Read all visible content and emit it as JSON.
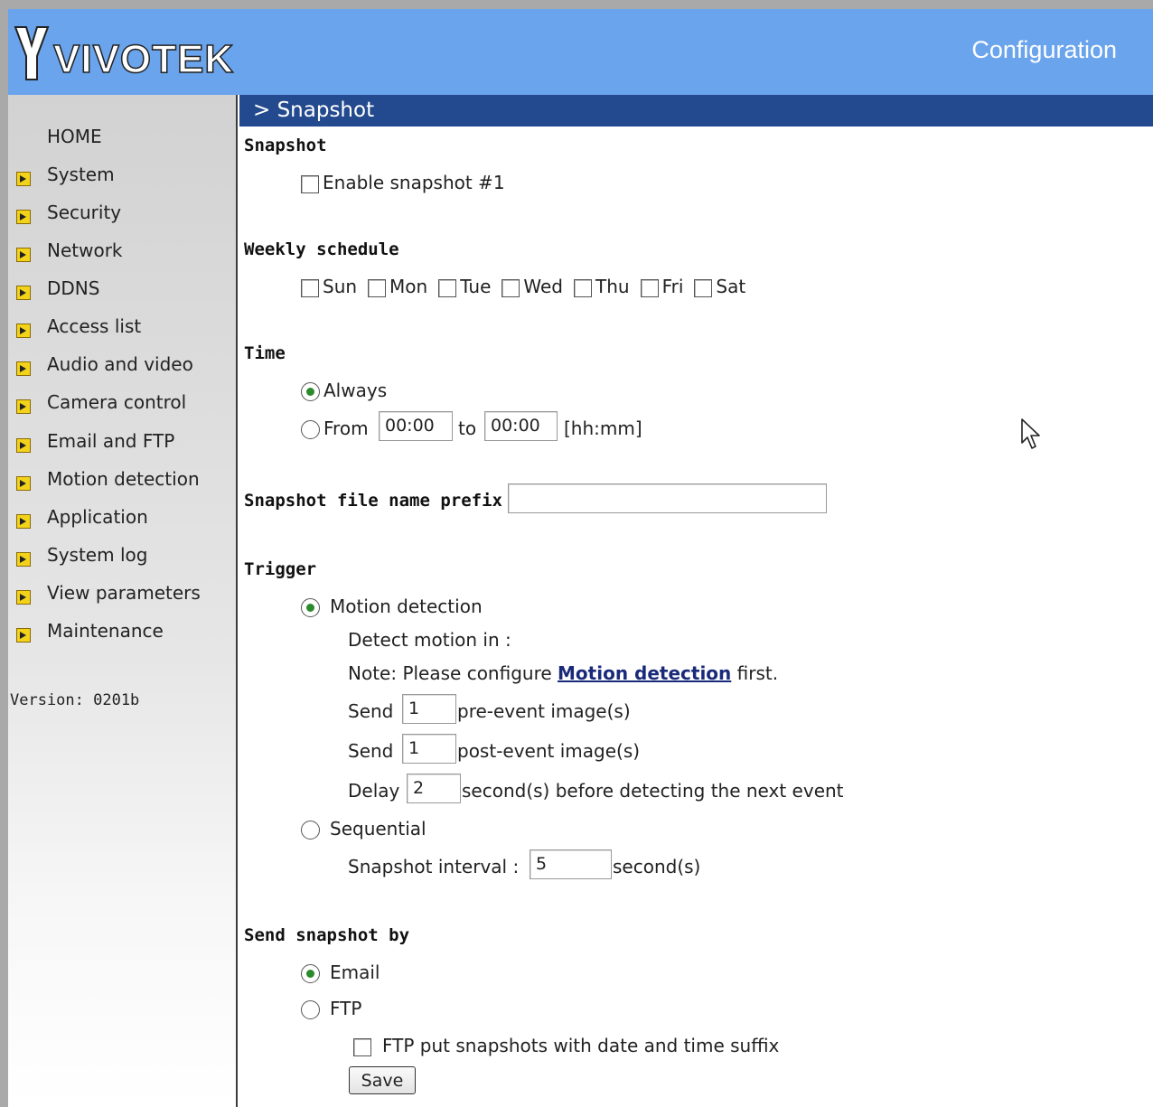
{
  "header": {
    "logo_text": "VIVOTEK",
    "title": "Configuration"
  },
  "sidebar": {
    "home": "HOME",
    "items": [
      {
        "label": "System"
      },
      {
        "label": "Security"
      },
      {
        "label": "Network"
      },
      {
        "label": "DDNS"
      },
      {
        "label": "Access list"
      },
      {
        "label": "Audio and video"
      },
      {
        "label": "Camera control"
      },
      {
        "label": "Email and FTP"
      },
      {
        "label": "Motion detection"
      },
      {
        "label": "Application"
      },
      {
        "label": "System log"
      },
      {
        "label": "View parameters"
      },
      {
        "label": "Maintenance"
      }
    ],
    "version": "Version: 0201b"
  },
  "page_title": "> Snapshot",
  "snapshot": {
    "title": "Snapshot",
    "enable_label": "Enable snapshot #1",
    "enable_checked": false
  },
  "weekly": {
    "title": "Weekly schedule",
    "days": [
      "Sun",
      "Mon",
      "Tue",
      "Wed",
      "Thu",
      "Fri",
      "Sat"
    ]
  },
  "time": {
    "title": "Time",
    "always_label": "Always",
    "from_label": "From",
    "from_value": "00:00",
    "to_label": "to",
    "to_value": "00:00",
    "format_hint": "[hh:mm]",
    "selected": "always"
  },
  "prefix": {
    "label": "Snapshot file name prefix",
    "value": ""
  },
  "trigger": {
    "title": "Trigger",
    "motion_label": "Motion detection",
    "detect_in_label": "Detect motion in :",
    "note_prefix": "Note: Please configure ",
    "note_link": "Motion detection",
    "note_suffix": " first.",
    "send_label": "Send",
    "pre_value": "1",
    "pre_label": "pre-event image(s)",
    "post_value": "1",
    "post_label": "post-event image(s)",
    "delay_label": "Delay",
    "delay_value": "2",
    "delay_suffix": "second(s) before detecting the next event",
    "sequential_label": "Sequential",
    "interval_label": "Snapshot interval :",
    "interval_value": "5",
    "interval_suffix": "second(s)",
    "selected": "motion"
  },
  "send_by": {
    "title": "Send snapshot by",
    "email_label": "Email",
    "ftp_label": "FTP",
    "ftp_suffix_label": "FTP put snapshots with date and time suffix",
    "selected": "email"
  },
  "save_label": "Save"
}
